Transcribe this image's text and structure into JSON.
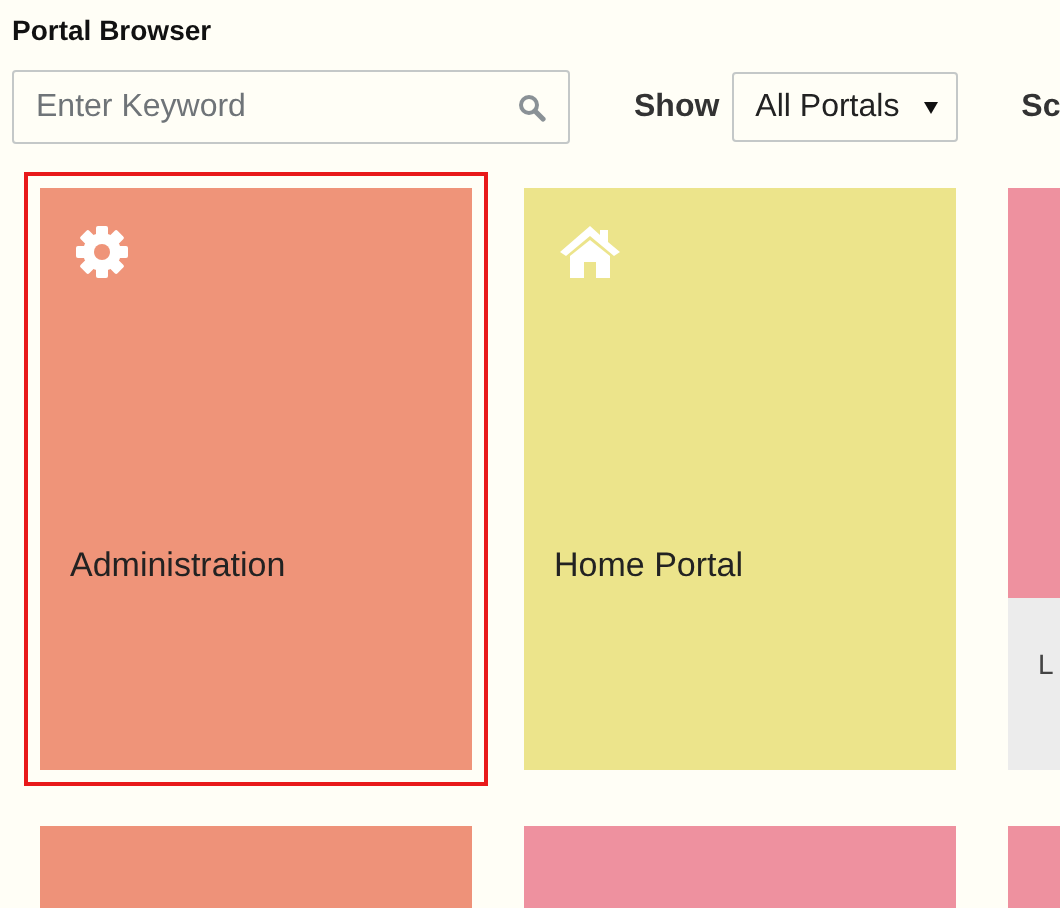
{
  "title": "Portal Browser",
  "search": {
    "placeholder": "Enter Keyword"
  },
  "show_label": "Show",
  "show_select": {
    "value": "All Portals"
  },
  "sort_label": "Sc",
  "cards": [
    {
      "kind": "gear",
      "label": "Administration",
      "color": "#ef9479",
      "selected": true
    },
    {
      "kind": "home",
      "label": "Home Portal",
      "color": "#ece48b",
      "selected": false
    },
    {
      "kind": "letters",
      "footer": "L",
      "color": "#ee919f",
      "selected": false
    },
    {
      "kind": "letters",
      "color": "#ee9279",
      "selected": false
    },
    {
      "kind": "letters",
      "color": "#ee919f",
      "selected": false
    },
    {
      "kind": "letters",
      "color": "#ee919f",
      "selected": false
    }
  ]
}
